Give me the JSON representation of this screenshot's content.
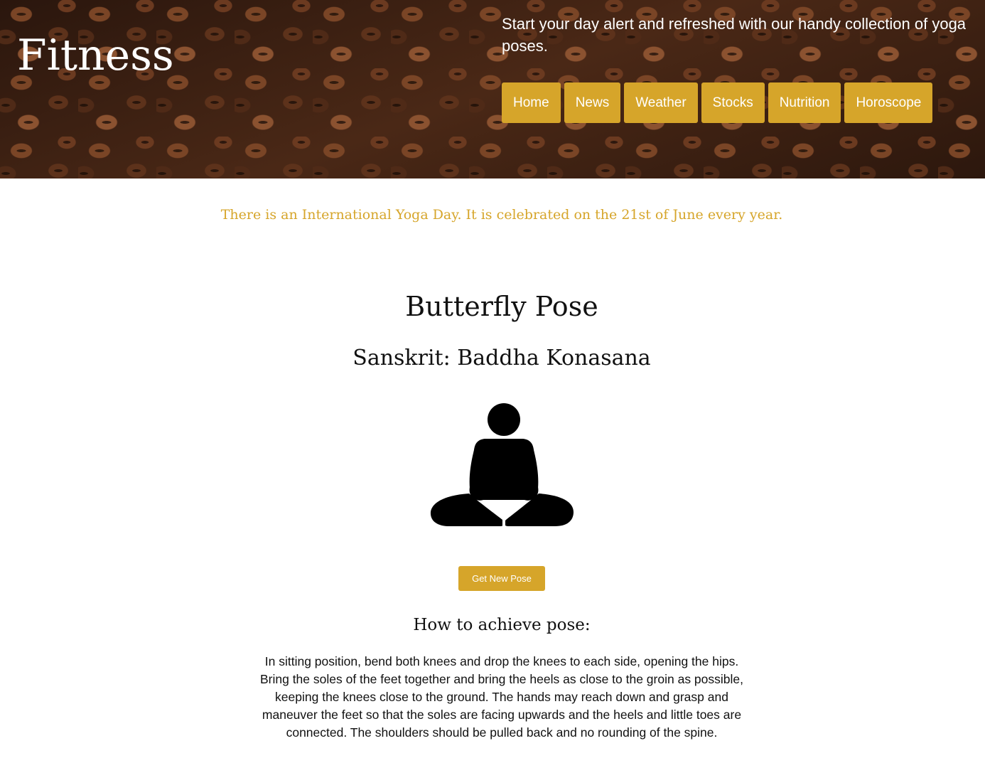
{
  "header": {
    "brand": "Fitness",
    "tagline": "Start your day alert and refreshed with our handy collection of yoga poses.",
    "background": "coffee-beans-image"
  },
  "nav": {
    "items": [
      {
        "label": "Home"
      },
      {
        "label": "News"
      },
      {
        "label": "Weather"
      },
      {
        "label": "Stocks"
      },
      {
        "label": "Nutrition"
      },
      {
        "label": "Horoscope"
      }
    ]
  },
  "main": {
    "fact": "There is an International Yoga Day. It is celebrated on the 21st of June every year.",
    "pose": {
      "name": "Butterfly Pose",
      "sanskrit": "Sanskrit: Baddha Konasana",
      "icon": "seated-meditation-icon"
    },
    "get_new_pose_label": "Get New Pose",
    "howto_title": "How to achieve pose:",
    "howto_text": "In sitting position, bend both knees and drop the knees to each side, opening the hips. Bring the soles of the feet together and bring the heels as close to the groin as possible, keeping the knees close to the ground. The hands may reach down and grasp and maneuver the feet so that the soles are facing upwards and the heels and little toes are connected. The shoulders should be pulled back and no rounding of the spine."
  },
  "colors": {
    "accent": "#d6a52a",
    "text": "#111111",
    "header_text": "#ffffff"
  }
}
